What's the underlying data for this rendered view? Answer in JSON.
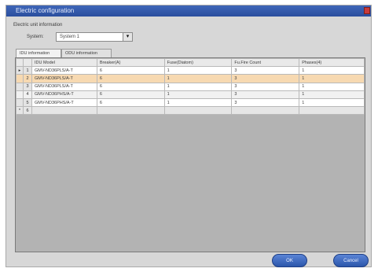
{
  "window": {
    "title": "Electric configuration"
  },
  "group_label": "Electric unit information",
  "system": {
    "label": "System:",
    "value": "System 1"
  },
  "tabs": [
    {
      "label": "IDU information"
    },
    {
      "label": "ODU information"
    }
  ],
  "table": {
    "headers": [
      "",
      "",
      "IDU Model",
      "Breaker(A)",
      "Fuse(Diatom)",
      "Fu.Fire Count",
      "Phases(4)"
    ],
    "rows": [
      {
        "indicator": "▸",
        "num": "1",
        "model": "GMV-ND36PLS/A-T",
        "breaker": "6",
        "fuse": "1",
        "count": "3",
        "phases": "1"
      },
      {
        "indicator": "",
        "num": "2",
        "model": "GMV-ND36PLS/A-T",
        "breaker": "6",
        "fuse": "1",
        "count": "3",
        "phases": "1"
      },
      {
        "indicator": "",
        "num": "3",
        "model": "GMV-ND36PLS/A-T",
        "breaker": "6",
        "fuse": "1",
        "count": "3",
        "phases": "1"
      },
      {
        "indicator": "",
        "num": "4",
        "model": "GMV-ND36PHS/A-T",
        "breaker": "6",
        "fuse": "1",
        "count": "3",
        "phases": "1"
      },
      {
        "indicator": "",
        "num": "5",
        "model": "GMV-ND36PHS/A-T",
        "breaker": "6",
        "fuse": "1",
        "count": "3",
        "phases": "1"
      }
    ],
    "new_row": {
      "indicator": "*",
      "num": "6"
    }
  },
  "buttons": {
    "ok": "OK",
    "cancel": "Cancel"
  },
  "colors": {
    "title_bar": "#2f56a8",
    "selected_row": "#f7d9b1",
    "button": "#3b63bf"
  }
}
